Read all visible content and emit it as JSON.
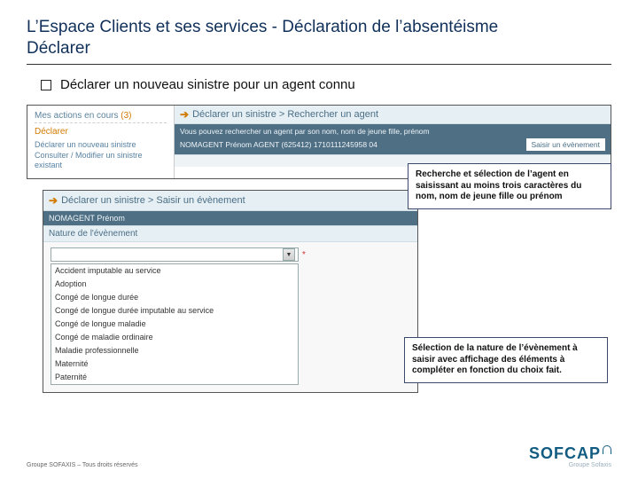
{
  "title": {
    "line1": "L’Espace Clients et ses services - Déclaration de l’absentéisme",
    "line2": "Déclarer"
  },
  "bullet": "Déclarer un nouveau sinistre pour un agent connu",
  "panel1": {
    "left": {
      "heading": "Mes actions en cours",
      "count": "(3)",
      "section": "Déclarer",
      "link1": "Déclarer un nouveau sinistre",
      "link2": "Consulter / Modifier un sinistre existant"
    },
    "breadcrumb": "Déclarer un sinistre > Rechercher un agent",
    "help": "Vous pouvez rechercher un agent par son nom, nom de jeune fille, prénom",
    "agent": "NOMAGENT Prénom AGENT (625412)  1710111245958 04",
    "button": "Saisir un évènement"
  },
  "callout1": "Recherche et sélection de l’agent en saisissant au moins trois caractères du nom, nom de jeune fille ou prénom",
  "panel2": {
    "breadcrumb": "Déclarer un sinistre > Saisir un évènement",
    "agent": "NOMAGENT Prénom",
    "section": "Nature de l'évènement",
    "options": [
      "Accident imputable au service",
      "Adoption",
      "Congé de longue durée",
      "Congé de longue durée imputable au service",
      "Congé de longue maladie",
      "Congé de maladie ordinaire",
      "Maladie professionnelle",
      "Maternité",
      "Paternité"
    ]
  },
  "callout2": "Sélection de la nature de l’évènement à saisir avec affichage des éléments à compléter en fonction du choix fait.",
  "footer": {
    "left": "Groupe SOFAXIS – Tous droits réservés",
    "logo_main": "SOFCAP",
    "logo_sub": "Groupe Sofaxis"
  }
}
